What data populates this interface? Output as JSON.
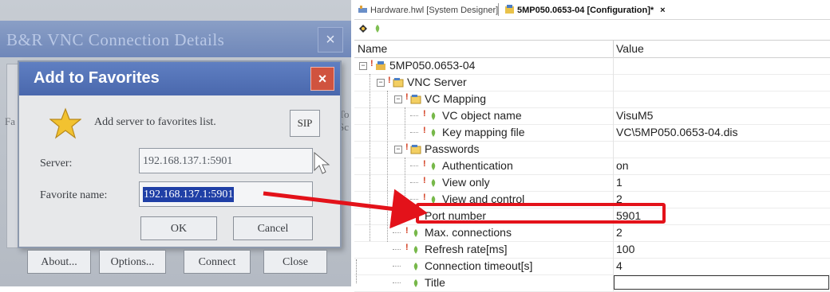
{
  "photo": {
    "background_dialog_title": "B&R VNC Connection Details",
    "background_close": "×",
    "side_text_left": "Fa",
    "side_text_right": [
      "To",
      "Sc"
    ],
    "dialog": {
      "title": "Add to Favorites",
      "close": "×",
      "message": "Add server to favorites list.",
      "sip_label": "SIP",
      "server_label": "Server:",
      "server_value": "192.168.137.1:5901",
      "favorite_label": "Favorite name:",
      "favorite_value": "192.168.137.1:5901",
      "ok_label": "OK",
      "cancel_label": "Cancel"
    },
    "bottom_buttons": {
      "about": "About...",
      "options": "Options...",
      "connect": "Connect",
      "close": "Close"
    }
  },
  "ide": {
    "tabs": [
      {
        "label": "Hardware.hwl [System Designer]",
        "active": false,
        "icon": "hardware-icon"
      },
      {
        "label": "5MP050.0653-04 [Configuration]*",
        "active": true,
        "icon": "configuration-icon"
      }
    ],
    "tab_close": "×",
    "grid": {
      "col_name": "Name",
      "col_value": "Value"
    },
    "rows": [
      {
        "name": "5MP050.0653-04",
        "value": ""
      },
      {
        "name": "VNC Server",
        "value": ""
      },
      {
        "name": "VC Mapping",
        "value": ""
      },
      {
        "name": "VC object name",
        "value": "VisuM5"
      },
      {
        "name": "Key mapping file",
        "value": "VC\\5MP050.0653-04.dis"
      },
      {
        "name": "Passwords",
        "value": ""
      },
      {
        "name": "Authentication",
        "value": "on"
      },
      {
        "name": "View only",
        "value": "1"
      },
      {
        "name": "View and control",
        "value": "2"
      },
      {
        "name": "Port number",
        "value": "5901"
      },
      {
        "name": "Max. connections",
        "value": "2"
      },
      {
        "name": "Refresh rate[ms]",
        "value": "100"
      },
      {
        "name": "Connection timeout[s]",
        "value": "4"
      },
      {
        "name": "Title",
        "value": ""
      }
    ]
  },
  "colors": {
    "highlight": "#e3121a",
    "selection": "#1f3fa6",
    "dialog_title_bar": "#4a68ad"
  }
}
